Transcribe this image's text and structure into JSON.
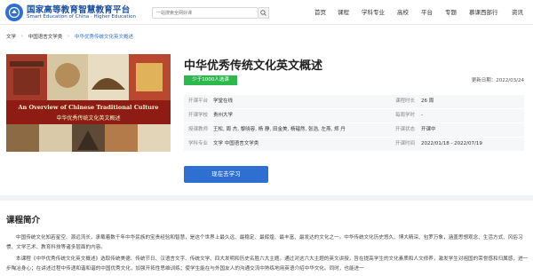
{
  "header": {
    "brand_cn": "国家高等教育智慧教育平台",
    "brand_en": "Smart Education of China · Higher Education",
    "search_placeholder": "一站搜索全网好课",
    "nav": [
      "首页",
      "课程",
      "学科专业",
      "高校",
      "平台",
      "专题",
      "慕课西部行",
      "资讯"
    ]
  },
  "breadcrumb": {
    "items": [
      "文学",
      "中国语言文学类",
      "中华优秀传统文化英文概述"
    ]
  },
  "course": {
    "cover_en": "An Overview of Chinese Traditional Culture",
    "cover_cn": "中华优秀传统文化英文概述",
    "title": "中华优秀传统文化英文概述",
    "learners_badge": "少于1000人选课",
    "updated": "更新日期：2022/03/24",
    "rows": [
      {
        "l1": "开课平台",
        "v1": "学堂在线",
        "l2": "课程时长",
        "v2": "26 周"
      },
      {
        "l1": "开课学校",
        "v1": "贵州大学",
        "l2": "每周学时",
        "v2": "-"
      },
      {
        "l1": "授课教师",
        "v1": "王松, 周 杰, 黎晓容, 杨 静, 田金美, 杨韫然, 张浩, 左燕, 郑 丹",
        "l2": "开课状态",
        "v2": "开课中"
      },
      {
        "l1": "学科专业",
        "v1": "文学 中国语言文学类",
        "l2": "开课时间",
        "v2": "2022/01/18 - 2022/07/19"
      }
    ],
    "study_button": "现在去学习"
  },
  "intro": {
    "heading": "课程简介",
    "p1": "中国传统文化知若星空、源远流长，承载着数千年中华民族的宝贵经验和智慧，是这个世界上最久远、最稳定、最辉煌、最丰富、最发达的文化之一。中华传统文化历史悠久、博大精深、包罗万象，涵盖思想观念、生活方式、风俗习惯、文学艺术、教育科技等诸多层面的内容。",
    "p2": "本课程《中华优秀传统文化英文概述》选取传统美德、传统节日、汉语言文字、传统文学、四大发明和历史名胜六大主题。通过对这六大主题的英文讲授，旨在提高学生的文化素质和人文修养，激发学生对祖国的荣誉感和归属感，进一步陶冶身心；在讲述过程中传递和谐和谐的中国优秀文化，加强开拓性思维训练；使学生能在与外国友人的沟通交流中熟练地用英语介绍中华文化。同时，也能进一"
  },
  "colors": {
    "accent": "#2f6fd1",
    "badge": "#2db84d"
  }
}
